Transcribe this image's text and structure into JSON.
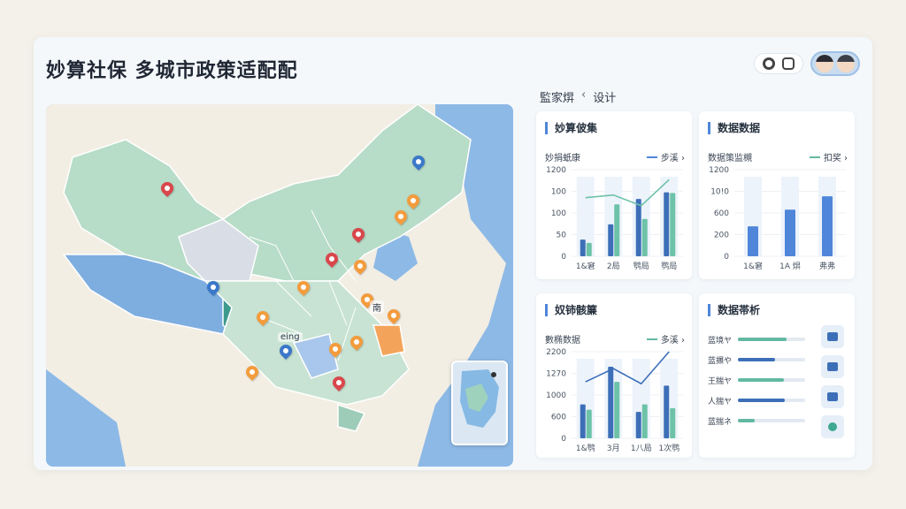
{
  "app": {
    "title": "妙算社保 多城市政策适配配"
  },
  "breadcrumb": {
    "home": "監家焺",
    "sep": "‹",
    "current": "设计"
  },
  "map": {
    "labels": {
      "south": "eing",
      "east": "南"
    },
    "pins": [
      {
        "color": "red"
      },
      {
        "color": "blue"
      },
      {
        "color": "orange"
      },
      {
        "color": "orange"
      },
      {
        "color": "red"
      },
      {
        "color": "orange"
      },
      {
        "color": "red"
      },
      {
        "color": "blue"
      },
      {
        "color": "orange"
      },
      {
        "color": "orange"
      },
      {
        "color": "blue"
      },
      {
        "color": "orange"
      },
      {
        "color": "orange"
      },
      {
        "color": "orange"
      },
      {
        "color": "red"
      },
      {
        "color": "orange"
      },
      {
        "color": "orange"
      }
    ]
  },
  "cards": {
    "c1": {
      "title": "妙算佊集",
      "subtitle": "妙捐蚔康",
      "legend": "步溪 ›"
    },
    "c2": {
      "title": "数据数据",
      "subtitle": "数据策监槻",
      "legend": "扣奖 ›"
    },
    "c3": {
      "title": "奴铈骸簾",
      "subtitle": "數椭数据",
      "legend": "多溪 ›"
    },
    "c4": {
      "title": "数据帯析",
      "rows": [
        {
          "label": "蓝境ヤ",
          "value": 0.72,
          "color": "#62b9a2"
        },
        {
          "label": "蓝搌や",
          "value": 0.55,
          "color": "#3d6fb8"
        },
        {
          "label": "王揣ヤ",
          "value": 0.68,
          "color": "#62b9a2"
        },
        {
          "label": "人揣ヤ",
          "value": 0.7,
          "color": "#3d6fb8"
        },
        {
          "label": "蓝揣ネ",
          "value": 0.25,
          "color": "#62b9a2"
        }
      ],
      "icons": [
        "folder-icon",
        "grid-icon",
        "lock-icon",
        "user-icon"
      ]
    }
  },
  "chart_data": [
    {
      "type": "bar",
      "categories": [
        "1&窘",
        "2局",
        "鹗局",
        "鹗局"
      ],
      "yticks": [
        "1200",
        "100",
        "100",
        "50",
        "0"
      ],
      "ylim": [
        0,
        1300
      ],
      "series": [
        {
          "values": [
            250,
            480,
            860,
            960
          ],
          "color": "#3d6fb8"
        },
        {
          "values": [
            200,
            780,
            560,
            950
          ],
          "color": "#6dc2a8"
        }
      ],
      "line": [
        880,
        920,
        760,
        1150
      ]
    },
    {
      "type": "bar",
      "categories": [
        "1&窘",
        "1A 焺",
        "弗弗"
      ],
      "yticks": [
        "1200",
        "10!0",
        "600",
        "200",
        "0"
      ],
      "ylim": [
        0,
        1300
      ],
      "series": [
        {
          "values": [
            450,
            700,
            900
          ],
          "color": "#4f86d9"
        }
      ]
    },
    {
      "type": "bar",
      "categories": [
        "1&鹗",
        "3月",
        "1八局",
        "1次鹗"
      ],
      "yticks": [
        "2200",
        "1270",
        "1000",
        "600",
        "0"
      ],
      "ylim": [
        0,
        2300
      ],
      "series": [
        {
          "values": [
            900,
            1900,
            700,
            1400
          ],
          "color": "#3d6fb8"
        },
        {
          "values": [
            760,
            1500,
            900,
            800
          ],
          "color": "#6dc2a8"
        }
      ],
      "line": [
        1500,
        1850,
        1450,
        2300
      ]
    }
  ]
}
